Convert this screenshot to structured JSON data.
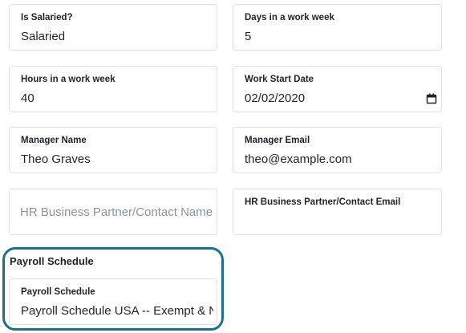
{
  "fields": {
    "is_salaried": {
      "label": "Is Salaried?",
      "value": "Salaried"
    },
    "days_in_work_week": {
      "label": "Days in a work week",
      "value": "5"
    },
    "hours_in_work_week": {
      "label": "Hours in a work week",
      "value": "40"
    },
    "work_start_date": {
      "label": "Work Start Date",
      "value": "02/02/2020",
      "icon": "calendar-icon"
    },
    "manager_name": {
      "label": "Manager Name",
      "value": "Theo Graves"
    },
    "manager_email": {
      "label": "Manager Email",
      "value": "theo@example.com"
    },
    "hr_contact_name": {
      "placeholder": "HR Business Partner/Contact Name",
      "value": ""
    },
    "hr_contact_email": {
      "label": "HR Business Partner/Contact Email",
      "value": ""
    }
  },
  "payroll": {
    "section_title": "Payroll Schedule",
    "field_label": "Payroll Schedule",
    "value": "Payroll Schedule USA -- Exempt & N"
  }
}
